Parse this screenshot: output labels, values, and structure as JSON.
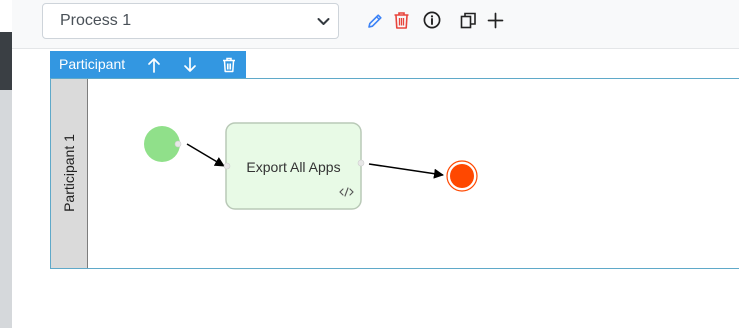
{
  "process_selector": {
    "value": "Process 1"
  },
  "participant_toolbar": {
    "label": "Participant"
  },
  "lane": {
    "label": "Participant 1"
  },
  "task": {
    "label": "Export All Apps"
  },
  "colors": {
    "accent": "#3397e1",
    "edit_icon": "#3b82f6",
    "delete_icon": "#e8453c",
    "start_event": "#90e08a",
    "end_event": "#ff4800",
    "task_fill": "#e8fae6"
  },
  "icons": [
    "chevron-down-icon",
    "pencil-icon",
    "trash-icon",
    "info-icon",
    "duplicate-icon",
    "plus-icon",
    "arrow-up-icon",
    "arrow-down-icon",
    "code-icon"
  ]
}
